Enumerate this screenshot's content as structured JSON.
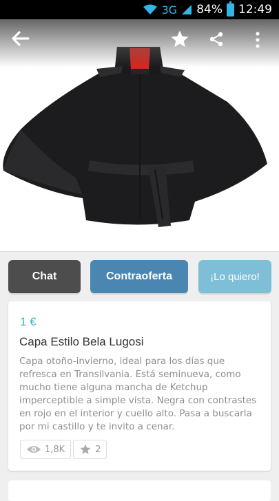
{
  "statusbar": {
    "network": "3G",
    "battery": "84%",
    "time": "12:49"
  },
  "actions": {
    "chat_label": "Chat",
    "offer_label": "Contraoferta",
    "want_label": "¡Lo quiero!"
  },
  "product": {
    "price": "1 €",
    "title": "Capa Estilo Bela Lugosi",
    "description": "Capa otoño-invierno, ideal para los días que refresca en Transilvania. Está seminueva, como mucho tiene alguna mancha de Ketchup imperceptible a simple vista. Negra con contrastes en rojo en el interior y cuello alto. Pasa a buscarla por mi castillo y te invito a cenar.",
    "views": "1,8K",
    "favorites": "2"
  },
  "colors": {
    "price": "#35b6c9",
    "chat": "#4d4d4d",
    "offer": "#4a86b1",
    "want": "#7ebfd7"
  }
}
